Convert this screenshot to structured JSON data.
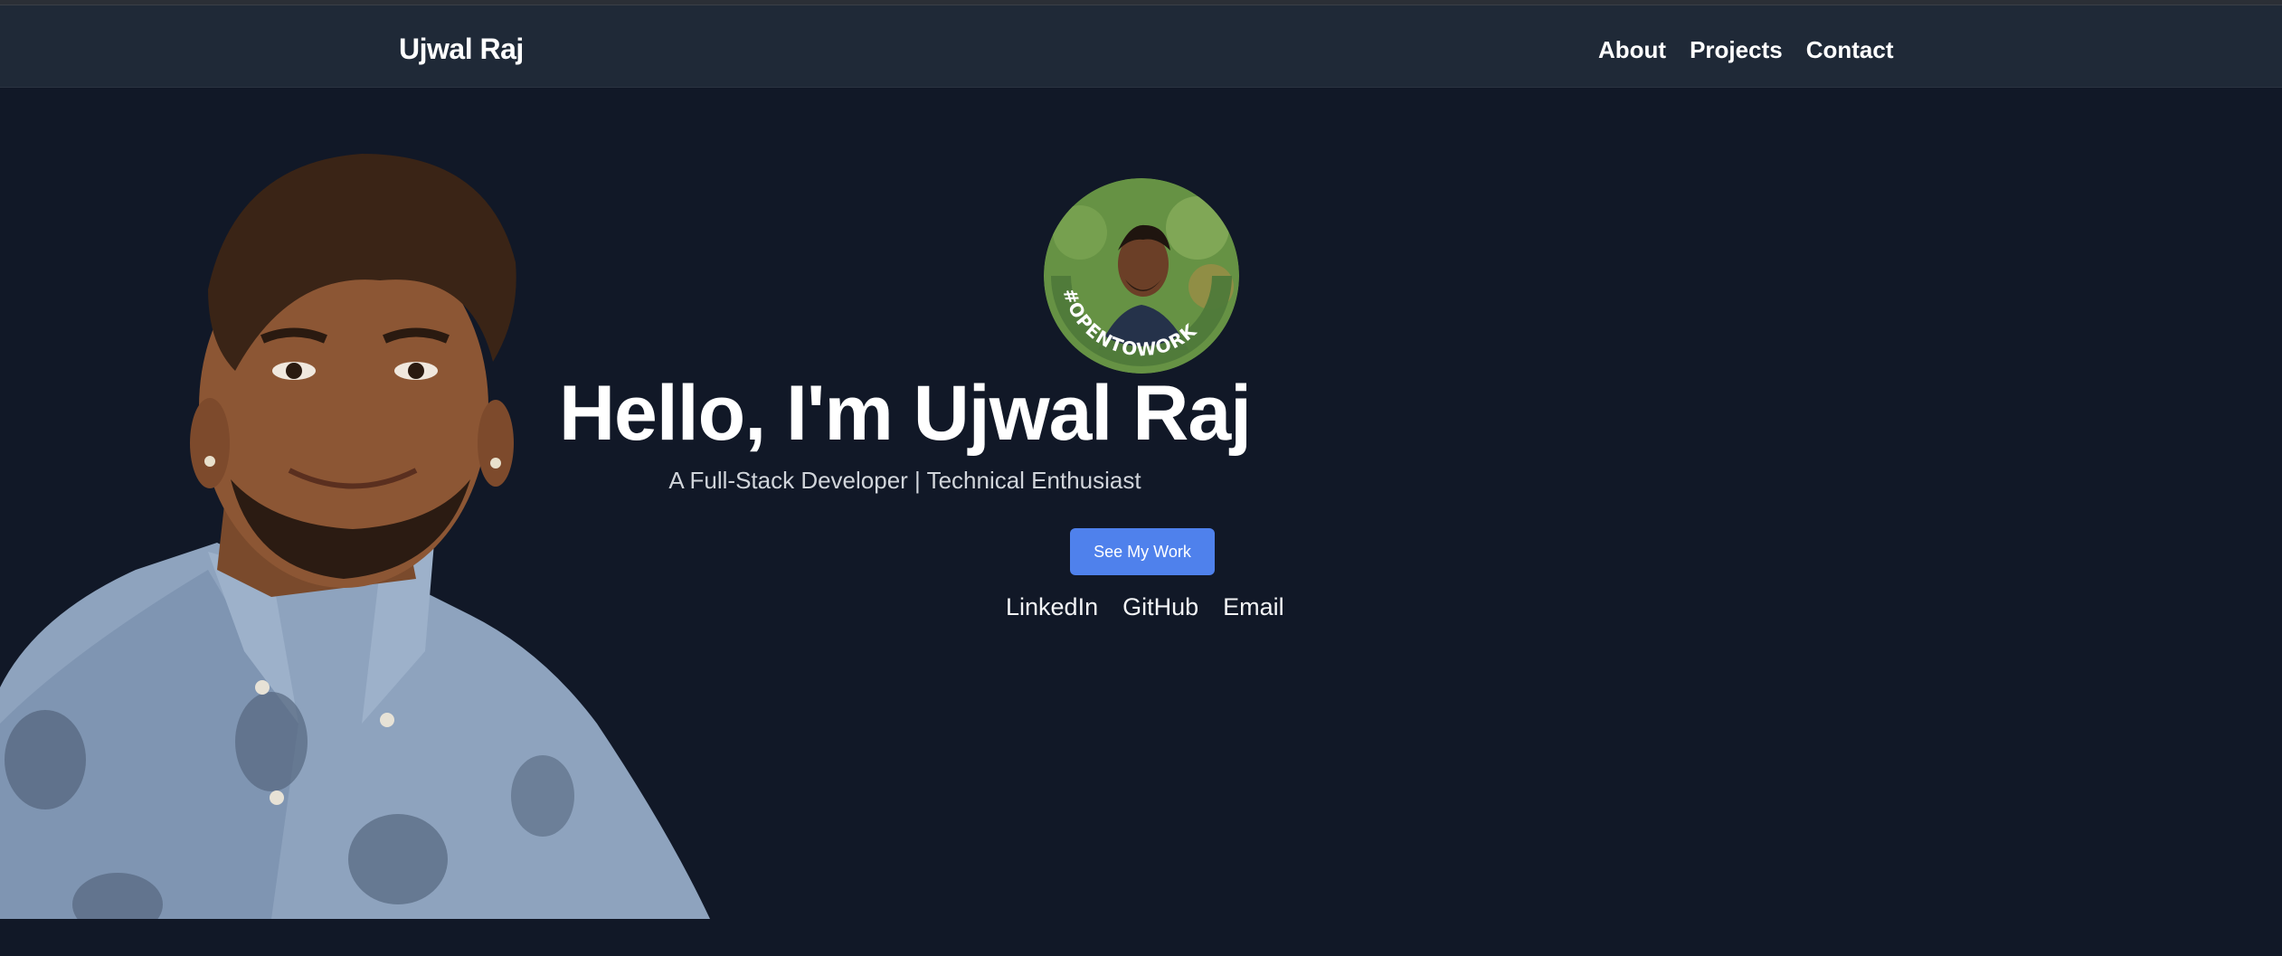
{
  "navbar": {
    "brand": "Ujwal Raj",
    "links": [
      {
        "label": "About"
      },
      {
        "label": "Projects"
      },
      {
        "label": "Contact"
      }
    ]
  },
  "hero": {
    "avatar_badge": "#OPENTOWORK",
    "heading": "Hello, I'm Ujwal Raj",
    "tagline": "A Full-Stack Developer | Technical Enthusiast",
    "cta_label": "See My Work",
    "social_links": [
      {
        "label": "LinkedIn"
      },
      {
        "label": "GitHub"
      },
      {
        "label": "Email"
      }
    ]
  },
  "colors": {
    "page_bg": "#111827",
    "navbar_bg": "#1f2937",
    "accent_button": "#4f81ec",
    "open_to_work_green": "#4f7a3a"
  }
}
